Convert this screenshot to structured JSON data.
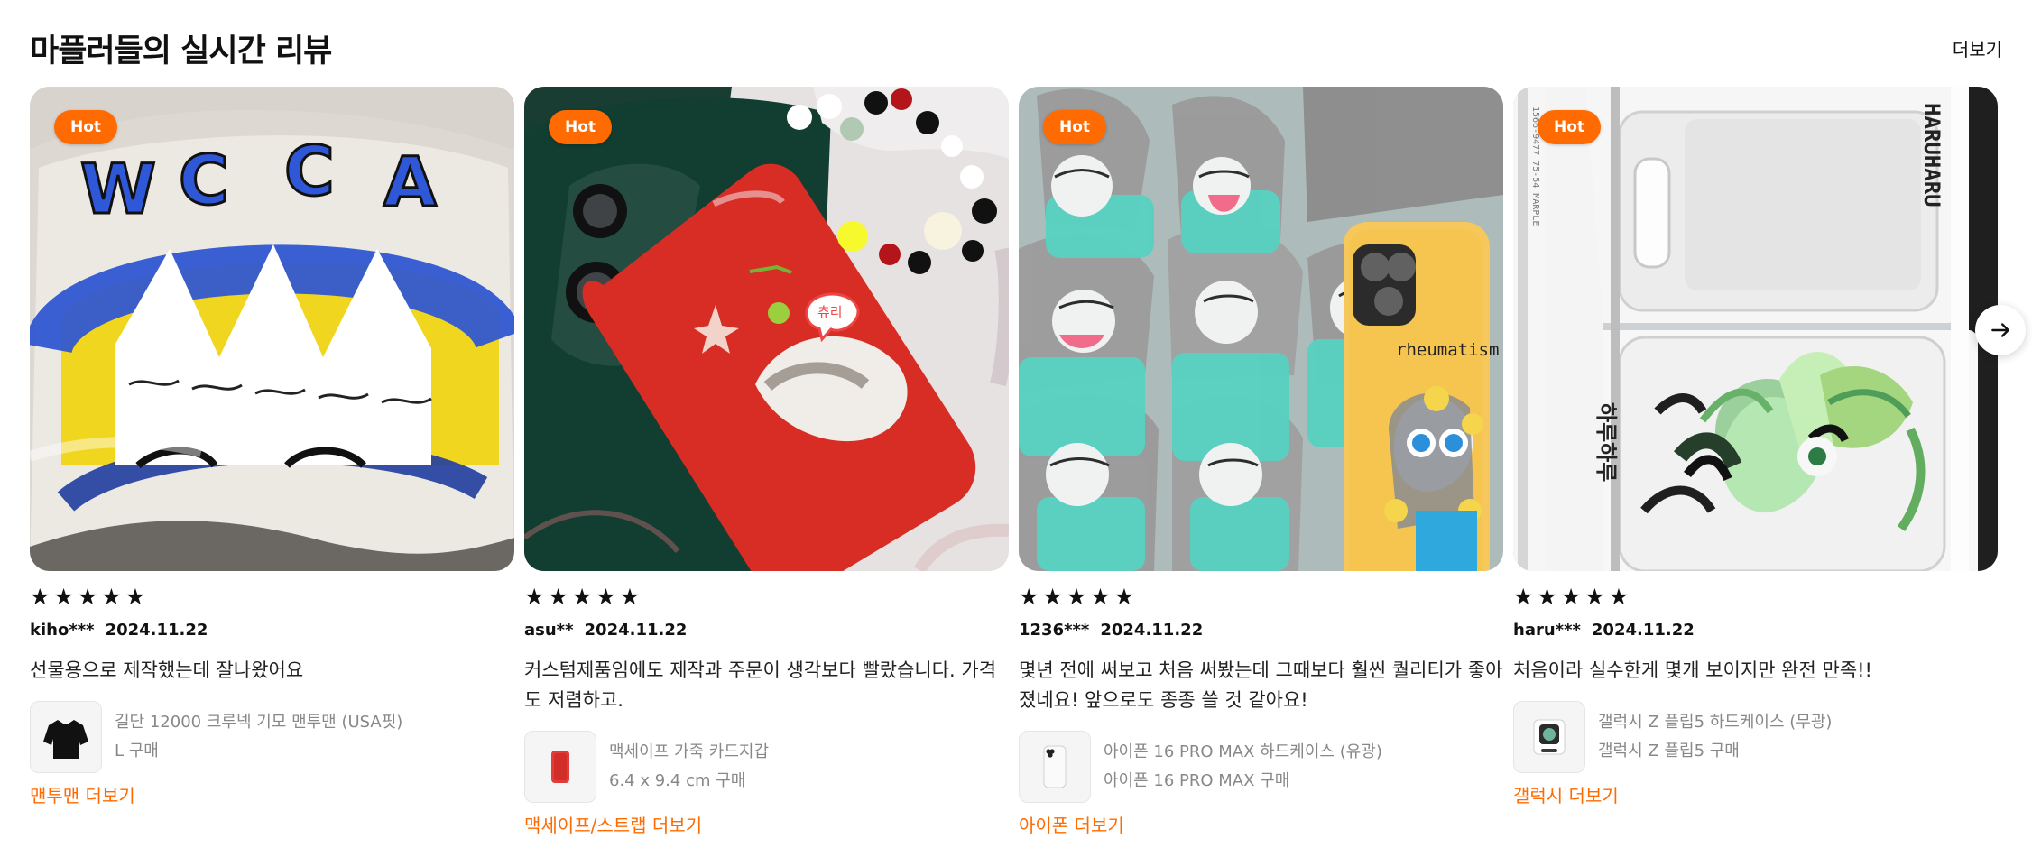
{
  "header": {
    "title": "마플러들의 실시간 리뷰",
    "more_label": "더보기"
  },
  "badge_label": "Hot",
  "reviews": [
    {
      "author": "kiho***",
      "date": "2024.11.22",
      "stars": 5,
      "text": "선물용으로 제작했는데 잘나왔어요",
      "product_name": "길단 12000 크루넥 기모 맨투맨 (USA핏)",
      "option": "L 구매",
      "cta": "맨투맨 더보기"
    },
    {
      "author": "asu**",
      "date": "2024.11.22",
      "stars": 5,
      "text": "커스텀제품임에도 제작과 주문이 생각보다 빨랐습니다. 가격도 저렴하고.",
      "product_name": "맥세이프 가죽 카드지갑",
      "option": "6.4 x 9.4 cm 구매",
      "cta": "맥세이프/스트랩 더보기"
    },
    {
      "author": "1236***",
      "date": "2024.11.22",
      "stars": 5,
      "text": "몇년 전에 써보고 처음 써봤는데 그때보다 훨씬 퀄리티가 좋아졌네요! 앞으로도 종종 쓸 것 같아요!",
      "product_name": "아이폰 16 PRO MAX 하드케이스 (유광)",
      "option": "아이폰 16 PRO MAX 구매",
      "cta": "아이폰 더보기"
    },
    {
      "author": "haru***",
      "date": "2024.11.22",
      "stars": 5,
      "text": "처음이라 실수한게 몇개 보이지만 완전 만족!!",
      "product_name": "갤럭시 Z 플립5 하드케이스 (무광)",
      "option": "갤럭시 Z 플립5 구매",
      "cta": "갤럭시 더보기"
    }
  ],
  "colors": {
    "accent": "#ff6b00",
    "text": "#111111",
    "muted": "#888888"
  },
  "icons": {
    "star": "★",
    "next": "arrow-right-icon"
  }
}
